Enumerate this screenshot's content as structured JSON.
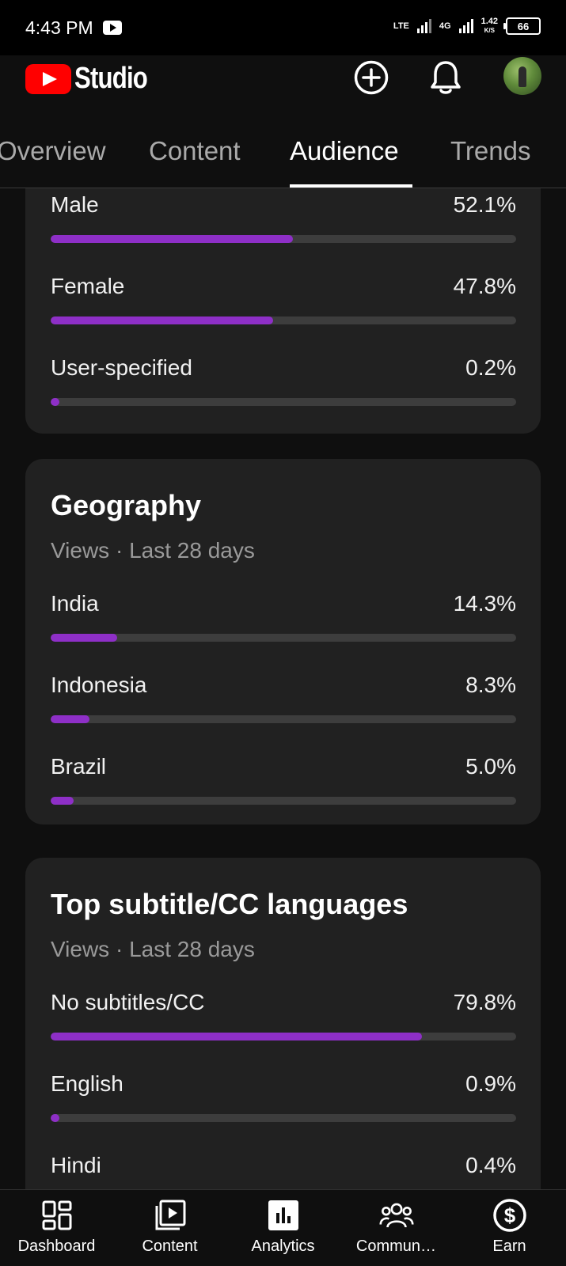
{
  "status_bar": {
    "time": "4:43 PM",
    "network_type": "LTE",
    "network_gen": "4G",
    "speed_value": "1.42",
    "speed_unit": "K/S",
    "battery": "66"
  },
  "header": {
    "logo_text": "Studio"
  },
  "tabs": [
    {
      "label": "Overview",
      "active": false
    },
    {
      "label": "Content",
      "active": false
    },
    {
      "label": "Audience",
      "active": true
    },
    {
      "label": "Trends",
      "active": false
    }
  ],
  "gender_card": {
    "rows": [
      {
        "label": "Male",
        "value": "52.1%",
        "fraction": 0.521
      },
      {
        "label": "Female",
        "value": "47.8%",
        "fraction": 0.478
      },
      {
        "label": "User-specified",
        "value": "0.2%",
        "fraction": 0.002
      }
    ]
  },
  "geography_card": {
    "title": "Geography",
    "subtitle": "Views · Last 28 days",
    "rows": [
      {
        "label": "India",
        "value": "14.3%",
        "fraction": 0.143
      },
      {
        "label": "Indonesia",
        "value": "8.3%",
        "fraction": 0.083
      },
      {
        "label": "Brazil",
        "value": "5.0%",
        "fraction": 0.05
      }
    ]
  },
  "subtitles_card": {
    "title": "Top subtitle/CC languages",
    "subtitle": "Views · Last 28 days",
    "rows": [
      {
        "label": "No subtitles/CC",
        "value": "79.8%",
        "fraction": 0.798
      },
      {
        "label": "English",
        "value": "0.9%",
        "fraction": 0.009
      },
      {
        "label": "Hindi",
        "value": "0.4%",
        "fraction": 0.004
      }
    ]
  },
  "bottom_nav": [
    {
      "label": "Dashboard",
      "icon": "dashboard-icon"
    },
    {
      "label": "Content",
      "icon": "content-icon"
    },
    {
      "label": "Analytics",
      "icon": "analytics-icon",
      "active": true
    },
    {
      "label": "Commun…",
      "icon": "community-icon"
    },
    {
      "label": "Earn",
      "icon": "earn-icon"
    }
  ],
  "colors": {
    "accent": "#8e2fc7",
    "track": "#3d3d3d",
    "card": "#212121",
    "background": "#0f0f0f",
    "brand_red": "#ff0000"
  }
}
